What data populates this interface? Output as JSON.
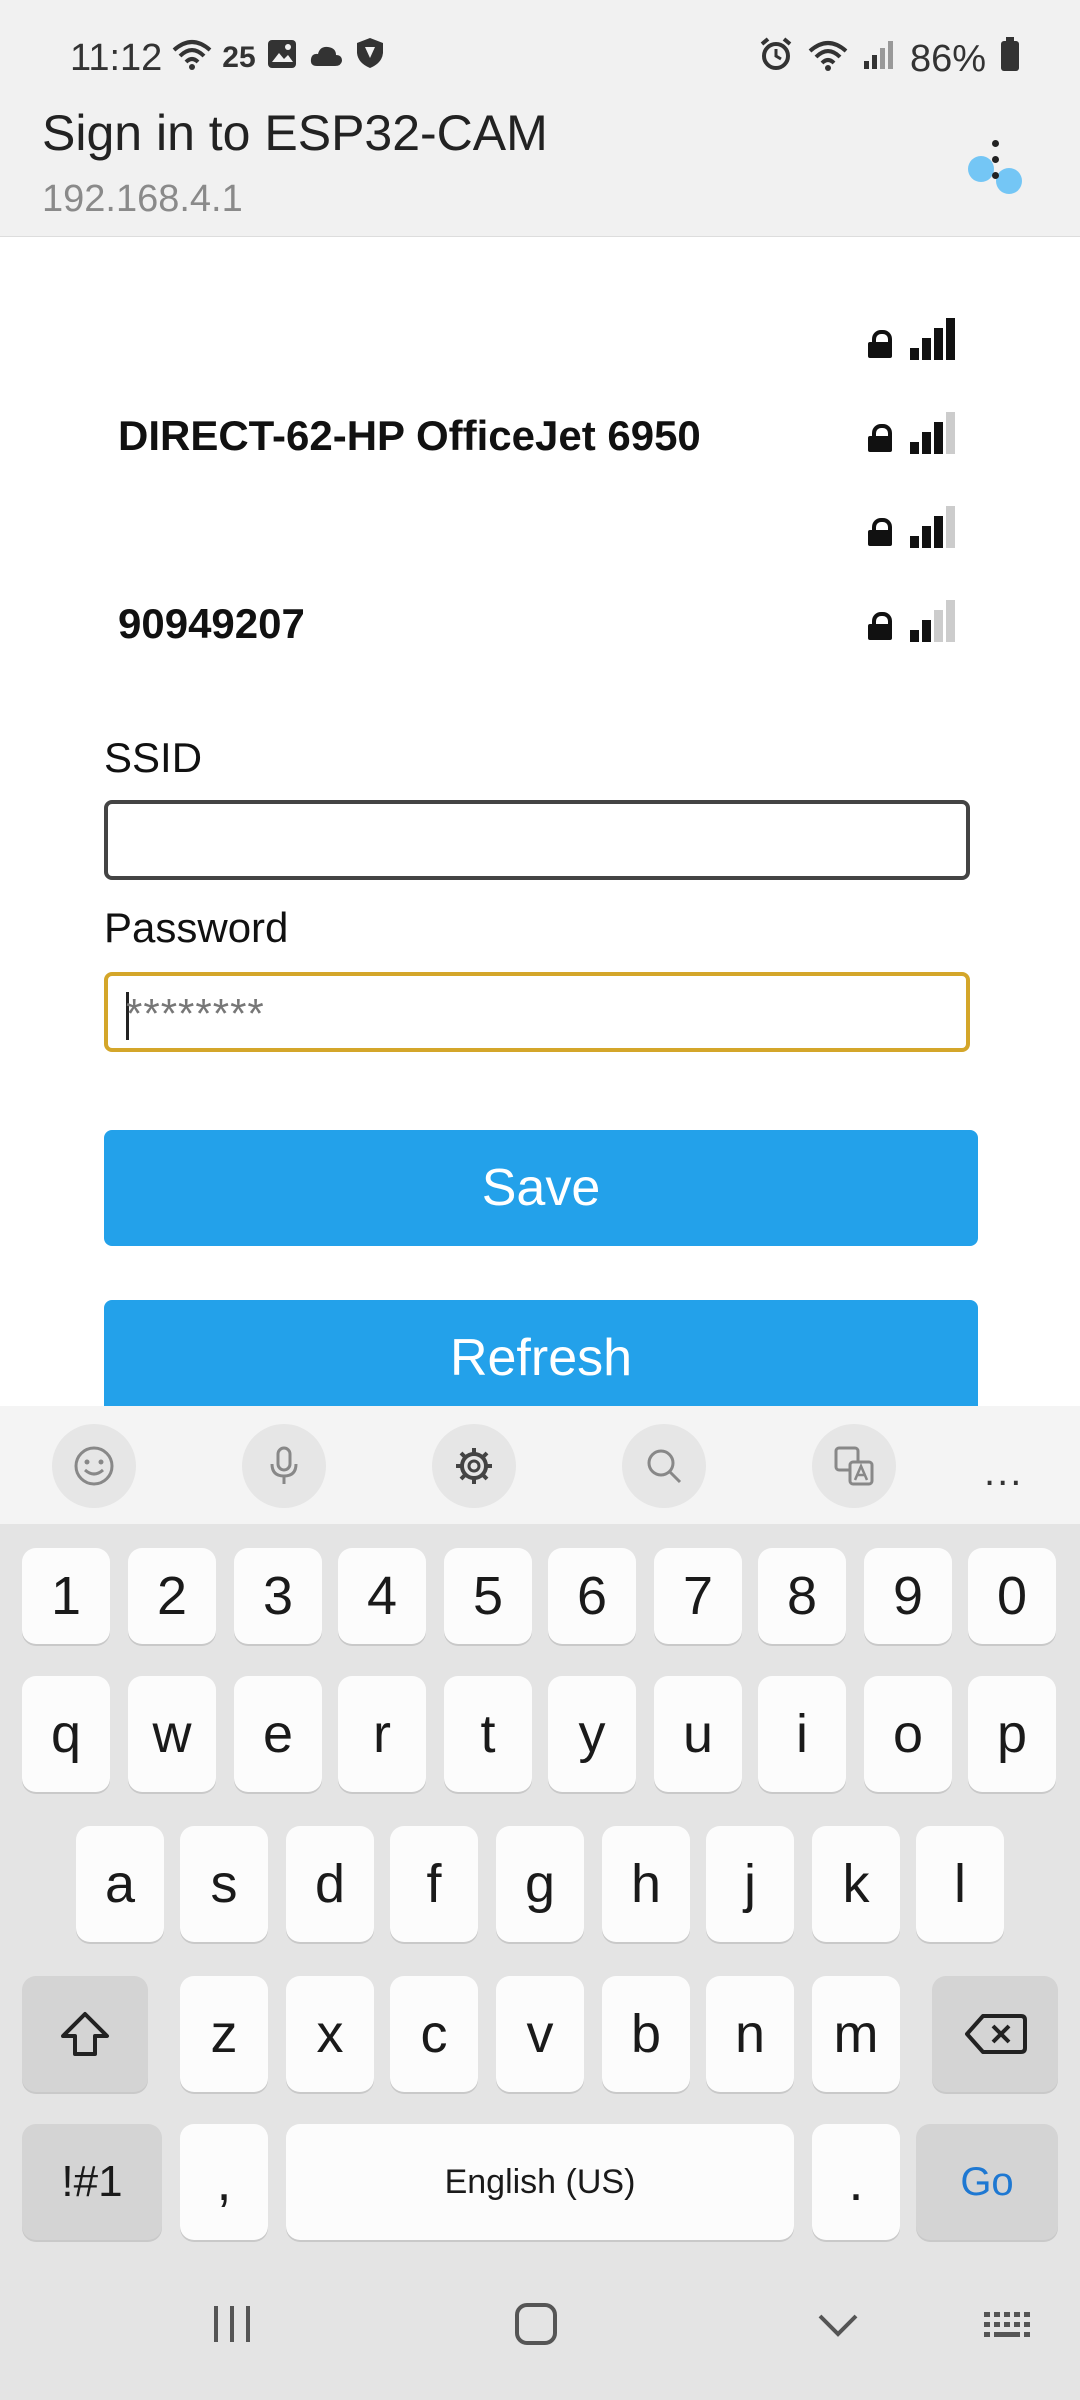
{
  "status_bar": {
    "time": "11:12",
    "wifi_badge": "25",
    "battery": "86%",
    "icons_left": [
      "wifi-icon",
      "image-icon",
      "cloud-icon",
      "shield-icon"
    ],
    "icons_right": [
      "alarm-icon",
      "wifi-icon",
      "signal-icon",
      "battery-icon"
    ]
  },
  "header": {
    "title": "Sign in to ESP32-CAM",
    "subtitle": "192.168.4.1"
  },
  "networks": [
    {
      "name": "",
      "signal_level": 4
    },
    {
      "name": "DIRECT-62-HP OfficeJet 6950",
      "signal_level": 3
    },
    {
      "name": "",
      "signal_level": 3
    },
    {
      "name": "90949207",
      "signal_level": 2
    }
  ],
  "form": {
    "ssid_label": "SSID",
    "ssid_value": "",
    "password_label": "Password",
    "password_placeholder": "********",
    "save_label": "Save",
    "refresh_label": "Refresh"
  },
  "keyboard": {
    "toolbar": [
      "emoji-icon",
      "microphone-icon",
      "settings-icon",
      "search-icon",
      "translate-icon",
      "more-icon"
    ],
    "more_label": "...",
    "rows": [
      [
        "1",
        "2",
        "3",
        "4",
        "5",
        "6",
        "7",
        "8",
        "9",
        "0"
      ],
      [
        "q",
        "w",
        "e",
        "r",
        "t",
        "y",
        "u",
        "i",
        "o",
        "p"
      ],
      [
        "a",
        "s",
        "d",
        "f",
        "g",
        "h",
        "j",
        "k",
        "l"
      ],
      [
        "z",
        "x",
        "c",
        "v",
        "b",
        "n",
        "m"
      ]
    ],
    "symbols_label": "!#1",
    "comma_label": ",",
    "space_label": "English (US)",
    "period_label": ".",
    "go_label": "Go"
  },
  "colors": {
    "accent": "#23A1EA",
    "focus_border": "#D4A62A",
    "go_text": "#1E78D2"
  }
}
